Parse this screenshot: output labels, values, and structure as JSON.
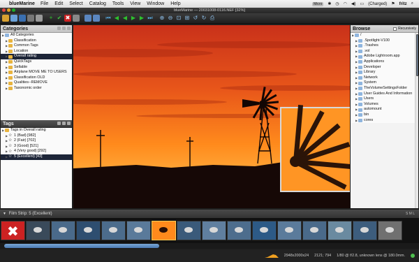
{
  "menubar": {
    "app_name": "blueMarine",
    "items": [
      "File",
      "Edit",
      "Select",
      "Catalog",
      "Tools",
      "View",
      "Window",
      "Help"
    ],
    "status": {
      "badge": "Micro",
      "battery": "(Charged)",
      "user": "fritz"
    }
  },
  "window": {
    "title": "blueMarine — 20031008-0116.NEF [32%]"
  },
  "categories": {
    "header": "Categories",
    "items": [
      {
        "label": "All Categories",
        "level": 0
      },
      {
        "label": "Classification",
        "level": 1
      },
      {
        "label": "Common Tags",
        "level": 1
      },
      {
        "label": "Location",
        "level": 1
      },
      {
        "label": "Overall rating",
        "level": 1,
        "selected": true
      },
      {
        "label": "QuickTags",
        "level": 1
      },
      {
        "label": "Sellable",
        "level": 1
      },
      {
        "label": "Airplane MOVE ME TO USERS",
        "level": 1
      },
      {
        "label": "Classification OLD",
        "level": 1
      },
      {
        "label": "Qualities--REMOVE",
        "level": 1
      },
      {
        "label": "Taxonomic order",
        "level": 1
      }
    ]
  },
  "tags": {
    "header": "Tags",
    "items": [
      {
        "label": "Tags in Overall rating",
        "level": 0
      },
      {
        "label": "1 (Bad) [982]",
        "level": 1
      },
      {
        "label": "2 (Fair) [702]",
        "level": 1
      },
      {
        "label": "3 (Good) [521]",
        "level": 1
      },
      {
        "label": "4 (Very good) [292]",
        "level": 1
      },
      {
        "label": "5 (Excellent) [43]",
        "level": 1,
        "selected": true
      }
    ]
  },
  "browse": {
    "header": "Browse",
    "recursively": "Recursively",
    "top_items": [
      "/",
      ".Spotlight-V100",
      ".Trashes",
      ".vol",
      "Adobe Lightroom.app",
      "Applications",
      "Developer",
      "Library",
      "Network",
      "System",
      "TheVolumeSettingsFolder",
      "User Guides And Information",
      "Users",
      "Volumes",
      "automount",
      "bin",
      "cores"
    ],
    "overlay_items": [
      ".Spotlight-V100",
      ".Trashes",
      ".vol",
      "Adobe Lightroom.app",
      "Applications",
      "Developer",
      "Library",
      "Network",
      "System",
      "TheVolumeSettingsFolder",
      "User Guides And Information",
      "Users",
      "Volumes"
    ]
  },
  "filmstrip": {
    "title": "Film Strip: 5 (Excellent)",
    "controls": "S M L",
    "thumb_count": 16,
    "selected_index": 6
  },
  "status": {
    "dimensions": "2948x2000x24",
    "cursor": "2121; 794",
    "exif": "1/80 @ f/2.8, unknown lens @ 180.0mm."
  },
  "colors": {
    "accent": "#1d2538",
    "sky": "#ff7a1a",
    "selection": "#ffcc55"
  }
}
